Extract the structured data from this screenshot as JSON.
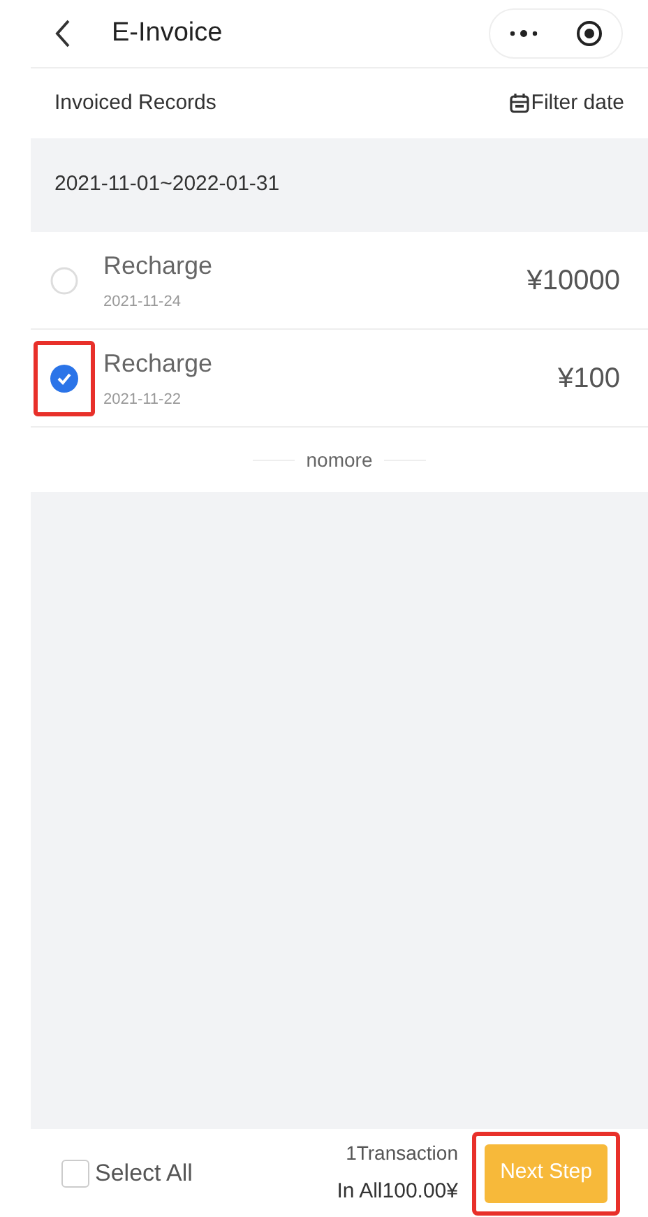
{
  "header": {
    "title": "E-Invoice"
  },
  "section": {
    "title": "Invoiced Records",
    "filter": "Filter date"
  },
  "date_range": "2021-11-01~2022-01-31",
  "records": [
    {
      "name": "Recharge",
      "date": "2021-11-24",
      "amount": "¥10000",
      "selected": false,
      "highlighted": false
    },
    {
      "name": "Recharge",
      "date": "2021-11-22",
      "amount": "¥100",
      "selected": true,
      "highlighted": true
    }
  ],
  "end_note": "nomore",
  "footer": {
    "select_all": {
      "label": "Select All",
      "checked": false
    },
    "count": "1Transaction",
    "total": "In All100.00¥",
    "next": {
      "label": "Next Step",
      "highlighted": true
    }
  }
}
